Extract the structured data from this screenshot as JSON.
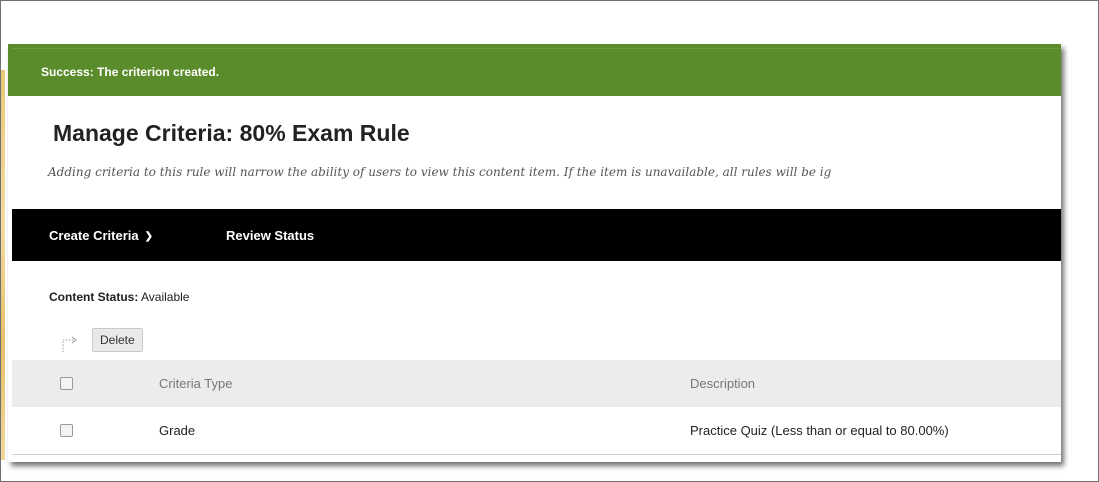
{
  "notification": {
    "message": "Success: The criterion created."
  },
  "page": {
    "title": "Manage Criteria: 80% Exam Rule",
    "subtitle": "Adding criteria to this rule will narrow the ability of users to view this content item. If the item is unavailable, all rules will be ig"
  },
  "action_bar": {
    "create_criteria_label": "Create Criteria",
    "review_status_label": "Review Status"
  },
  "content_status": {
    "label": "Content Status:",
    "value": "Available"
  },
  "toolbar": {
    "delete_label": "Delete"
  },
  "table": {
    "columns": [
      "Criteria Type",
      "Description"
    ],
    "rows": [
      {
        "criteria_type": "Grade",
        "description": "Practice Quiz (Less than or equal to 80.00%)",
        "checked": false
      }
    ]
  },
  "colors": {
    "success_green": "#5b8c2b",
    "action_bar_black": "#000000",
    "header_row_gray": "#ececec"
  }
}
